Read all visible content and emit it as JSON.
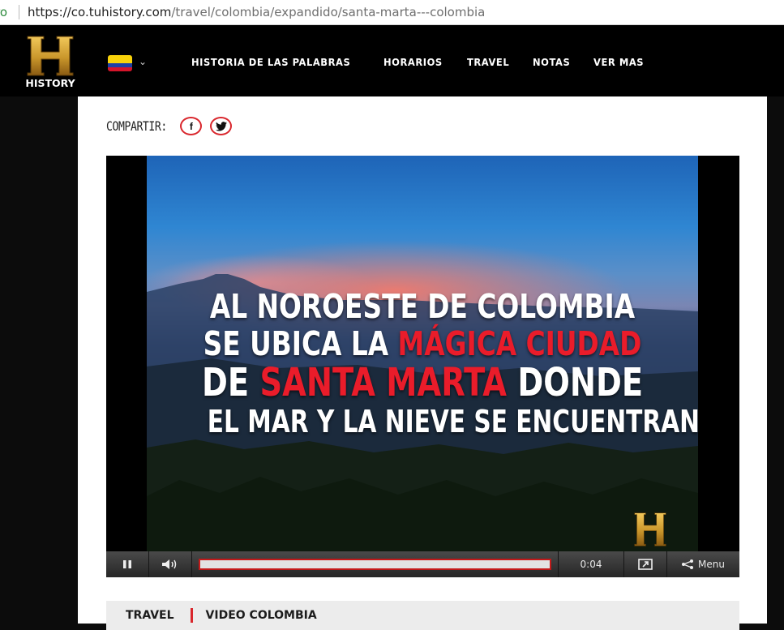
{
  "browser": {
    "security_fragment": "ro",
    "url_host": "https://co.tuhistory.com",
    "url_path": "/travel/colombia/expandido/santa-marta---colombia"
  },
  "header": {
    "logo_text": "HISTORY",
    "nav": [
      "HISTORIA DE LAS PALABRAS",
      "HORARIOS",
      "TRAVEL",
      "NOTAS",
      "VER MAS"
    ]
  },
  "share": {
    "label": "COMPARTIR:",
    "facebook_glyph": "f",
    "twitter_glyph": "🐦"
  },
  "video": {
    "overlay": {
      "line1": "AL NOROESTE DE COLOMBIA",
      "line2_a": "SE UBICA LA ",
      "line2_b": "MÁGICA CIUDAD",
      "line3_a": "DE ",
      "line3_b": "SANTA MARTA",
      "line3_c": " DONDE",
      "line4": "EL MAR Y LA NIEVE SE ENCUENTRAN"
    },
    "controls": {
      "time": "0:04",
      "menu_label": "Menu",
      "progress": 0.0
    }
  },
  "breadcrumb": [
    "TRAVEL",
    "VIDEO COLOMBIA"
  ],
  "colors": {
    "brand_red": "#d9262c",
    "logo_gold": "#c9962b"
  }
}
